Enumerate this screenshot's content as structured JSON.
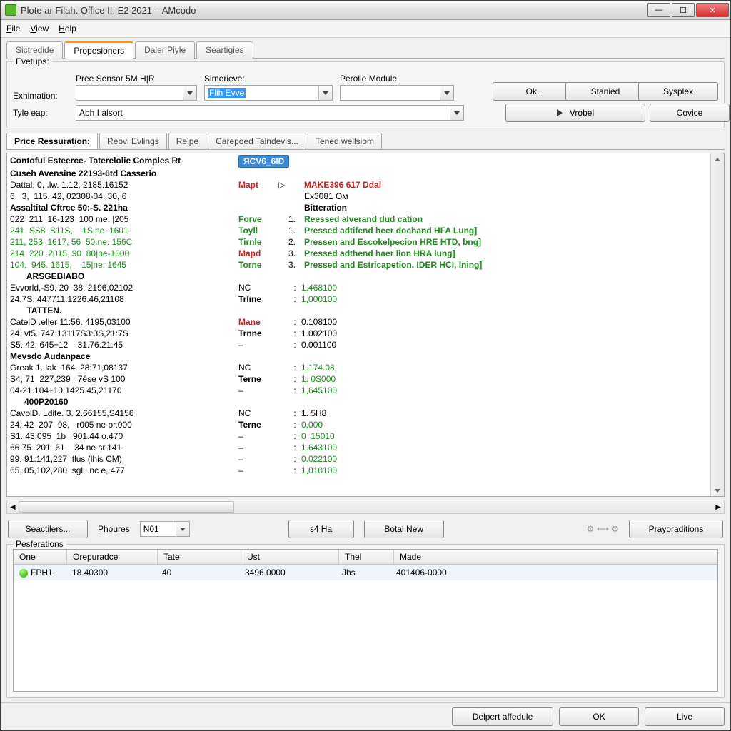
{
  "window": {
    "title": "Plote ar Filah. Office II. E2 2021 – AMcodo"
  },
  "menu": {
    "file": "File",
    "view": "View",
    "help": "Help"
  },
  "topTabs": [
    "Sictredide",
    "Propesioners",
    "Daler Piyle",
    "Seartigies"
  ],
  "topTabActive": 1,
  "group": {
    "legend": "Evetups:",
    "exhLabel": "Exhimation:",
    "tyleLabel": "Tyle eap:",
    "preLabel": "Pree Sensor 5M H|R",
    "preValue": "",
    "simLabel": "Simerieve:",
    "simValue": "Flih Evve",
    "perLabel": "Perolie Module",
    "perValue": "",
    "tyleValue": "Abh I alsort"
  },
  "buttons": {
    "ok": "Ok.",
    "started": "Stanied",
    "sysplex": "Sysplex",
    "vrobel": "Vrobel",
    "covice": "Covice"
  },
  "subTabs": [
    "Price Ressuration:",
    "Rebvi Evlings",
    "Reipe",
    "Carepoed Talndevis...",
    "Tened wellsiom"
  ],
  "subTabActive": 0,
  "log": {
    "header1a": "Contoful Esteerce- Taterelolie Comples Rt",
    "header1badge": "ЯCV6_6ID",
    "header2": "Cuseh Avensine 22193-6td Casserio",
    "rows": [
      {
        "left": "Dattal, 0, .lw. 1.12, 2185.16152",
        "tag": "Mapt",
        "tagcls": "red b",
        "right": "MAKE396 617 Ddal",
        "rcls": "red b",
        "icon": "cursor"
      },
      {
        "left": "6.  3,  115. 42, 02308-04. 30, 6",
        "right": "Ex3081 Oм",
        "rcls": "blk"
      },
      {
        "left": "Assaltital Cftrce 50:-S. 221ha",
        "lcls": "b",
        "right": "Bitteration",
        "rcls": "blk b"
      },
      {
        "left": "022  211  16-123  100 me. |205",
        "tag": "Forve",
        "tagcls": "grn b",
        "num": "1.",
        "right": "Reessed alverand dud cation",
        "rcls": "grn b"
      },
      {
        "left": "241  SS8  S11S,    1S|ne. 1601",
        "lcls": "grn",
        "tag": "Toyll",
        "tagcls": "grn b",
        "num": "1.",
        "right": "Pressed adtifend heer dochand HFA Lung]",
        "rcls": "grn b"
      },
      {
        "left": "211, 253  1617, 56  50.ne. 156C",
        "lcls": "grn",
        "tag": "Tirnle",
        "tagcls": "grn b",
        "num": "2.",
        "right": "Pressen and Escokelpecion HRE HTD, bng]",
        "rcls": "grn b"
      },
      {
        "left": "214  220  2015, 90  80|ne-1000",
        "lcls": "grn",
        "tag": "Mapd",
        "tagcls": "red b",
        "num": "3.",
        "right": "Pressed adthend haer lion HRA lung]",
        "rcls": "grn b"
      },
      {
        "left": "104,  945. 1615,    15|пe. 1645",
        "lcls": "grn",
        "tag": "Torne",
        "tagcls": "grn b",
        "num": "3.",
        "right": "Pressed and Estricapetion. IDER HCI, lning]",
        "rcls": "grn b"
      },
      {
        "left": "       ARSGEBIABO",
        "lcls": "b"
      },
      {
        "left": "Evvorld,-S9. 20  38, 2196,02102",
        "tag": "NC",
        "sep": ":",
        "right": "1.468100",
        "rcls": "grn"
      },
      {
        "left": "24.7S, 447711.1226.46,21108",
        "tag": "Trline",
        "tagcls": "b",
        "sep": ":",
        "right": "1,000100",
        "rcls": "grn"
      },
      {
        "left": "       TATTEN.",
        "lcls": "b"
      },
      {
        "left": "CatelD .eller 11:56. 4195,03100",
        "tag": "Mane",
        "tagcls": "red b",
        "sep": ":",
        "right": "0.108100"
      },
      {
        "left": "24. vt5. 747.13117S3:3S,21:7S",
        "tag": "Trnne",
        "tagcls": "b",
        "sep": ":",
        "right": "1.002100"
      },
      {
        "left": "S5. 42. 645÷12    31.76.21.45",
        "tag": "–",
        "sep": ":",
        "right": "0.001100"
      },
      {
        "left": "Mevsdo Audanpace",
        "lcls": "b"
      },
      {
        "left": "Greak 1. lak  164. 28:71,08137",
        "tag": "NC",
        "sep": ":",
        "right": "1.174.08",
        "rcls": "grn"
      },
      {
        "left": "S4, 71  227,239   7ése vS 100",
        "tag": "Terne",
        "tagcls": "b",
        "sep": ":",
        "right": "1. 0S000",
        "rcls": "grn"
      },
      {
        "left": "04-21.104÷10 1425.45,21170",
        "tag": "–",
        "sep": ":",
        "right": "1,645100",
        "rcls": "grn"
      },
      {
        "left": "      400P20160",
        "lcls": "b"
      },
      {
        "left": "CavolD. Ldite. 3. 2.66155,S4156",
        "tag": "NC",
        "sep": ":",
        "right": "1. 5H8"
      },
      {
        "left": "24. 42  207  98,   r005 ne or.000",
        "tag": "Terne",
        "tagcls": "b",
        "sep": ":",
        "right": "0,000",
        "rcls": "grn"
      },
      {
        "left": "S1. 43.095  1b   901.44 o.470",
        "tag": "–",
        "sep": ":",
        "right": "0  15010",
        "rcls": "grn"
      },
      {
        "left": "66.75  201  61    34 ne sr.141",
        "tag": "–",
        "sep": ":",
        "right": "1.643100",
        "rcls": "grn"
      },
      {
        "left": "99, 91.141,227  tlus (lhis CM)",
        "tag": "–",
        "sep": ":",
        "right": "0.022100",
        "rcls": "grn"
      },
      {
        "left": "65, 05,102,280  sgll. nc e,.477",
        "tag": "–",
        "sep": ":",
        "right": "1,010100",
        "rcls": "grn"
      }
    ]
  },
  "midbar": {
    "seact": "Seactilers...",
    "phoures": "Phoures",
    "phouresVal": "N01",
    "ha": "ɛ4 Ha",
    "botal": "Botal New",
    "pray": "Prayoraditions"
  },
  "pesf": {
    "legend": "Pesferations",
    "cols": [
      "One",
      "Orepuradce",
      "Tate",
      "Ust",
      "Thel",
      "Made"
    ],
    "row": {
      "one": "FPH1",
      "orep": "18.40300",
      "tate": "40",
      "ust": "3496.0000",
      "thel": "Jhs",
      "made": "401406-0000"
    }
  },
  "footer": {
    "delpert": "Delpert affedule",
    "ok": "OK",
    "live": "Live"
  }
}
